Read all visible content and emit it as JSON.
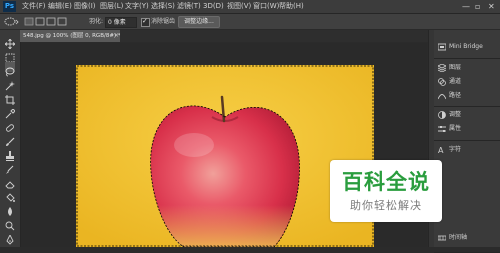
{
  "app": {
    "logo": "Ps"
  },
  "menubar": {
    "items": [
      "文件(F)",
      "编辑(E)",
      "图像(I)",
      "图层(L)",
      "文字(Y)",
      "选择(S)",
      "滤镜(T)",
      "3D(D)",
      "视图(V)",
      "窗口(W)",
      "帮助(H)"
    ],
    "window_controls": [
      "—",
      "▫",
      "✕"
    ]
  },
  "options": {
    "feather_label": "羽化:",
    "feather_value": "0 像素",
    "antialias_label": "消除锯齿",
    "refine_edge_button": "调整边缘..."
  },
  "document": {
    "tab_title": "548.jpg @ 100% (图层 0, RGB/8#) *",
    "close_glyph": "×"
  },
  "panels": {
    "items": [
      {
        "label": "Mini Bridge",
        "icon": "mini-bridge-icon"
      },
      {
        "label": "图层",
        "icon": "layers-icon"
      },
      {
        "label": "通道",
        "icon": "channels-icon"
      },
      {
        "label": "路径",
        "icon": "paths-icon"
      },
      {
        "label": "调整",
        "icon": "adjustments-icon"
      },
      {
        "label": "属性",
        "icon": "properties-icon"
      },
      {
        "label": "字符",
        "icon": "character-icon"
      },
      {
        "label": "时间轴",
        "icon": "timeline-icon"
      }
    ]
  },
  "watermark": {
    "main": "百科全说",
    "sub": "助你轻松解决"
  },
  "colors": {
    "canvas_background": "#f2c12e",
    "apple_red": "#e03a4e",
    "watermark_green": "#2a9d3e"
  }
}
